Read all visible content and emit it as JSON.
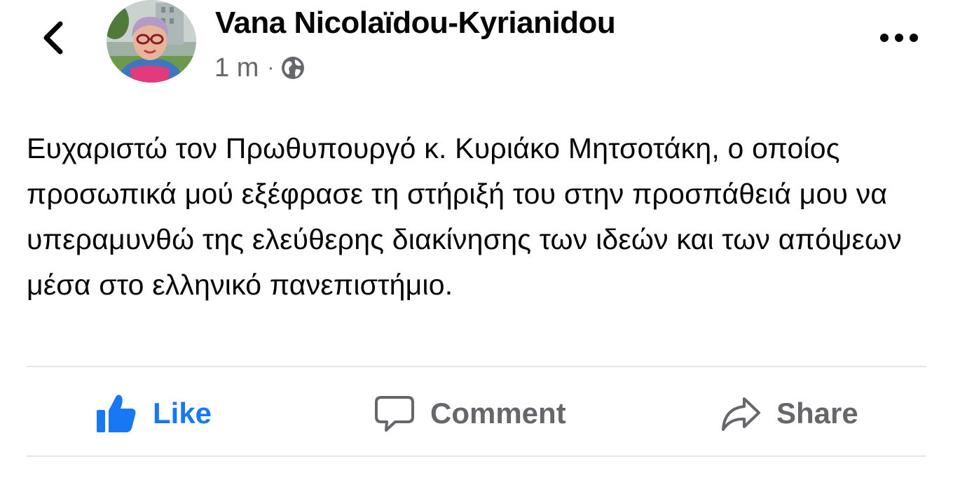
{
  "header": {
    "author_name": "Vana Nicolaïdou-Kyrianidou",
    "timestamp": "1 m",
    "separator": "·",
    "audience_icon": "globe-icon",
    "back_icon": "chevron-left-icon",
    "more_icon": "more-horizontal-icon"
  },
  "post": {
    "text": "Ευχαριστώ τον Πρωθυπουργό κ. Κυριάκο Μητσοτάκη, ο οποίος   προσωπικά μού εξέφρασε τη στήριξή του στην προσπάθειά μου να υπεραμυνθώ της ελεύθερης διακίνησης των ιδεών και των απόψεων μέσα στο ελληνικό πανεπιστήμιο."
  },
  "actions": {
    "like_label": "Like",
    "comment_label": "Comment",
    "share_label": "Share"
  },
  "colors": {
    "like_blue": "#1877f2",
    "secondary_gray": "#65676b",
    "text": "#050505",
    "divider": "#e4e6eb"
  }
}
